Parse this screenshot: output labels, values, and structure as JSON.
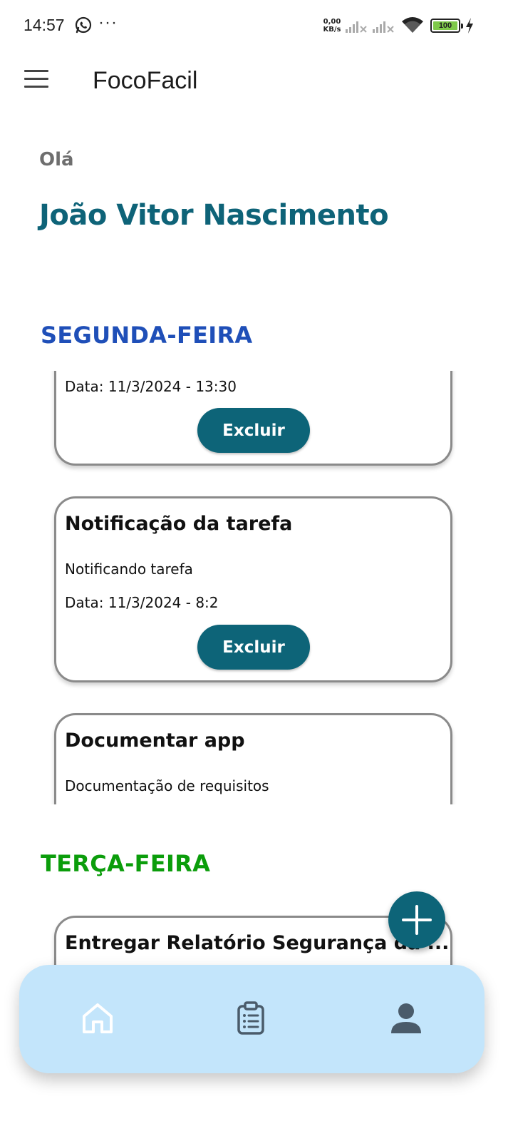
{
  "status_bar": {
    "time": "14:57",
    "net_speed_value": "0,00",
    "net_speed_unit": "KB/s",
    "battery": "100",
    "icons": [
      "whatsapp-icon",
      "more-dots-icon",
      "signal-icon",
      "signal-icon",
      "wifi-icon",
      "battery-icon",
      "charging-icon"
    ]
  },
  "app_bar": {
    "title": "FocoFacil",
    "menu_icon": "hamburger-menu-icon"
  },
  "greeting": {
    "hello": "Olá",
    "name": "João Vitor Nascimento"
  },
  "colors": {
    "primary": "#0d6478",
    "monday": "#1f4fb8",
    "tuesday": "#0b9d0b",
    "nav_bg": "#c3e5fb"
  },
  "days": [
    {
      "title": "SEGUNDA-FEIRA",
      "tasks": [
        {
          "title": "",
          "description": "",
          "date": "Data: 11/3/2024 - 13:30",
          "button": "Excluir"
        },
        {
          "title": "Notificação da tarefa",
          "description": "Notificando tarefa",
          "date": "Data: 11/3/2024 - 8:2",
          "button": "Excluir"
        },
        {
          "title": "Documentar app",
          "description": "Documentação de requisitos",
          "date": "",
          "button": ""
        }
      ]
    },
    {
      "title": "TERÇA-FEIRA",
      "tasks": [
        {
          "title": "Entregar Relatório Segurança da ...",
          "description": "",
          "date": "",
          "button": ""
        }
      ]
    }
  ],
  "fab": {
    "icon": "plus-icon"
  },
  "bottom_nav": {
    "items": [
      "home-icon",
      "task-list-icon",
      "profile-icon"
    ],
    "active": "home-icon"
  }
}
